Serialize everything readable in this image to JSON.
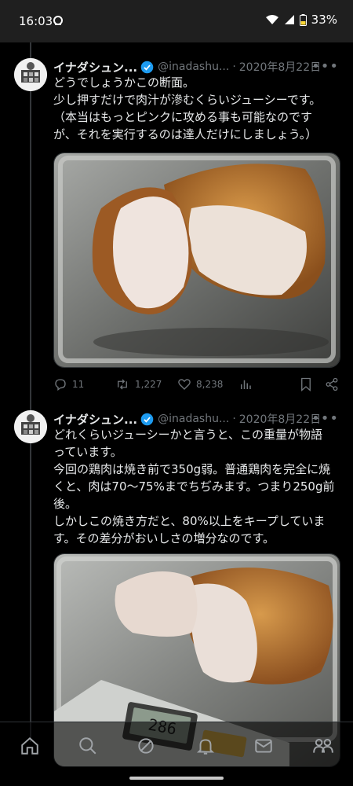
{
  "status_bar": {
    "time": "16:03",
    "battery": "33%"
  },
  "tweets": [
    {
      "name": "イナダシュン...",
      "handle": "@inadashu...",
      "date": "2020年8月22日",
      "text_lines": [
        "どうでしょうかこの断面。",
        "少し押すだけで肉汁が滲むくらいジューシーです。",
        "（本当はもっとピンクに攻める事も可能なのです",
        "が、それを実行するのは達人だけにしましょう。）"
      ],
      "replies": "11",
      "retweets": "1,227",
      "likes": "8,238"
    },
    {
      "name": "イナダシュン...",
      "handle": "@inadashu...",
      "date": "2020年8月22日",
      "text_lines": [
        "どれくらいジューシーかと言うと、この重量が物語",
        "っています。",
        "今回の鶏肉は焼き前で350g弱。普通鶏肉を完全に焼",
        "くと、肉は70〜75%までちぢみます。つまり250g前",
        "後。",
        "しかしこの焼き方だと、80%以上をキープしていま",
        "す。その差分がおいしさの増分なのです。"
      ],
      "scale_reading": "286"
    }
  ],
  "colors": {
    "verified": "#1d9bf0",
    "muted": "#71767b",
    "text": "#e7e9ea"
  },
  "bottom_nav": [
    "home-icon",
    "search-icon",
    "spaces-icon",
    "notifications-icon",
    "messages-icon",
    "communities-icon"
  ]
}
